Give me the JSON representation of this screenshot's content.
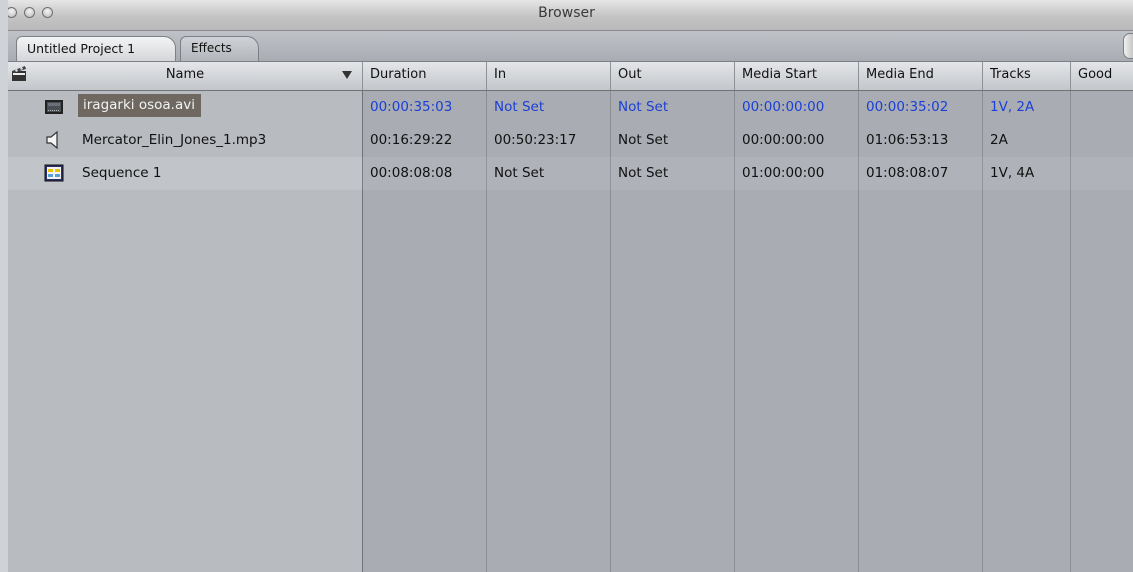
{
  "window": {
    "title": "Browser"
  },
  "tabs": [
    {
      "label": "Untitled Project 1",
      "active": true
    },
    {
      "label": "Effects",
      "active": false
    }
  ],
  "columns": {
    "name": "Name",
    "duration": "Duration",
    "in": "In",
    "out": "Out",
    "media_start": "Media Start",
    "media_end": "Media End",
    "tracks": "Tracks",
    "good": "Good"
  },
  "rows": [
    {
      "icon": "video-clip-icon",
      "name": "iragarki osoa.avi",
      "selected": true,
      "duration": "00:00:35:03",
      "in": "Not Set",
      "out": "Not Set",
      "media_start": "00:00:00:00",
      "media_end": "00:00:35:02",
      "tracks": "1V, 2A",
      "highlight_color": "#1b3fd6"
    },
    {
      "icon": "audio-clip-icon",
      "name": "Mercator_Elin_Jones_1.mp3",
      "selected": false,
      "duration": "00:16:29:22",
      "in": "00:50:23:17",
      "out": "Not Set",
      "media_start": "00:00:00:00",
      "media_end": "01:06:53:13",
      "tracks": "2A"
    },
    {
      "icon": "sequence-icon",
      "name": "Sequence 1",
      "selected": false,
      "duration": "00:08:08:08",
      "in": "Not Set",
      "out": "Not Set",
      "media_start": "01:00:00:00",
      "media_end": "01:08:08:07",
      "tracks": "1V, 4A"
    }
  ]
}
